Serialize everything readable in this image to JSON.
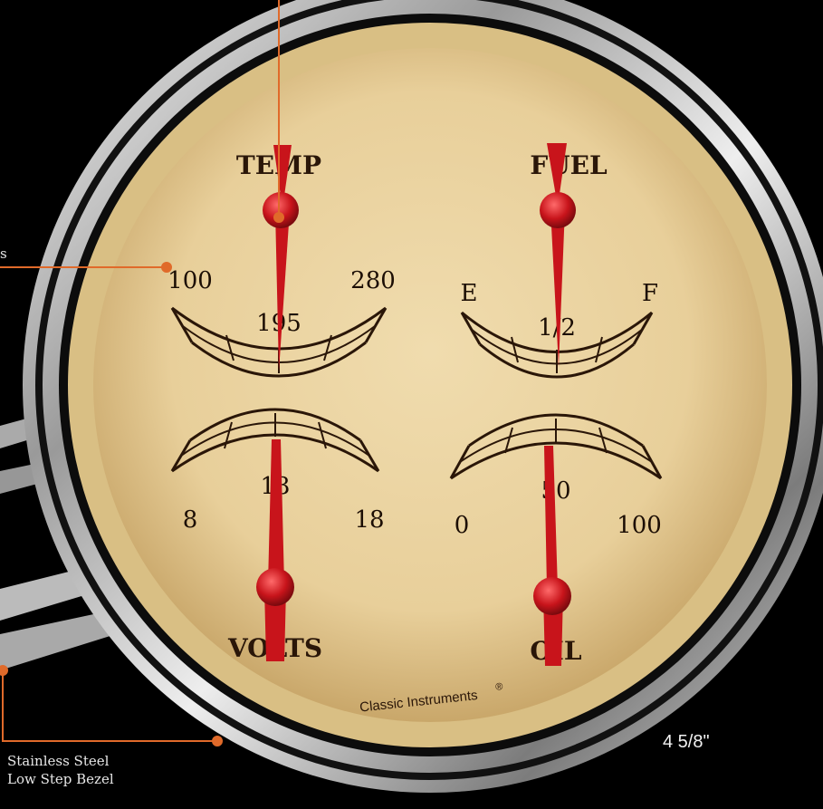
{
  "gauge": {
    "temp": {
      "title": "TEMP",
      "min_label": "100",
      "mid_label": "195",
      "max_label": "280"
    },
    "fuel": {
      "title": "FUEL",
      "min_label": "E",
      "mid_label": "1/2",
      "max_label": "F"
    },
    "volts": {
      "title": "VOLTS",
      "min_label": "8",
      "mid_label": "13",
      "max_label": "18"
    },
    "oil": {
      "title": "OIL",
      "min_label": "0",
      "mid_label": "50",
      "max_label": "100"
    },
    "brand": "Classic Instruments",
    "brand_mark": "®"
  },
  "callouts": {
    "partial_label": "s",
    "bezel_line1": "Stainless Steel",
    "bezel_line2": "Low Step Bezel"
  },
  "size_label": "4 5/8\"",
  "colors": {
    "background": "#000000",
    "dial_face": "#ead3a0",
    "needle": "#c8141b",
    "callout_line": "#e06a2a",
    "dial_ink": "#2a1608"
  }
}
